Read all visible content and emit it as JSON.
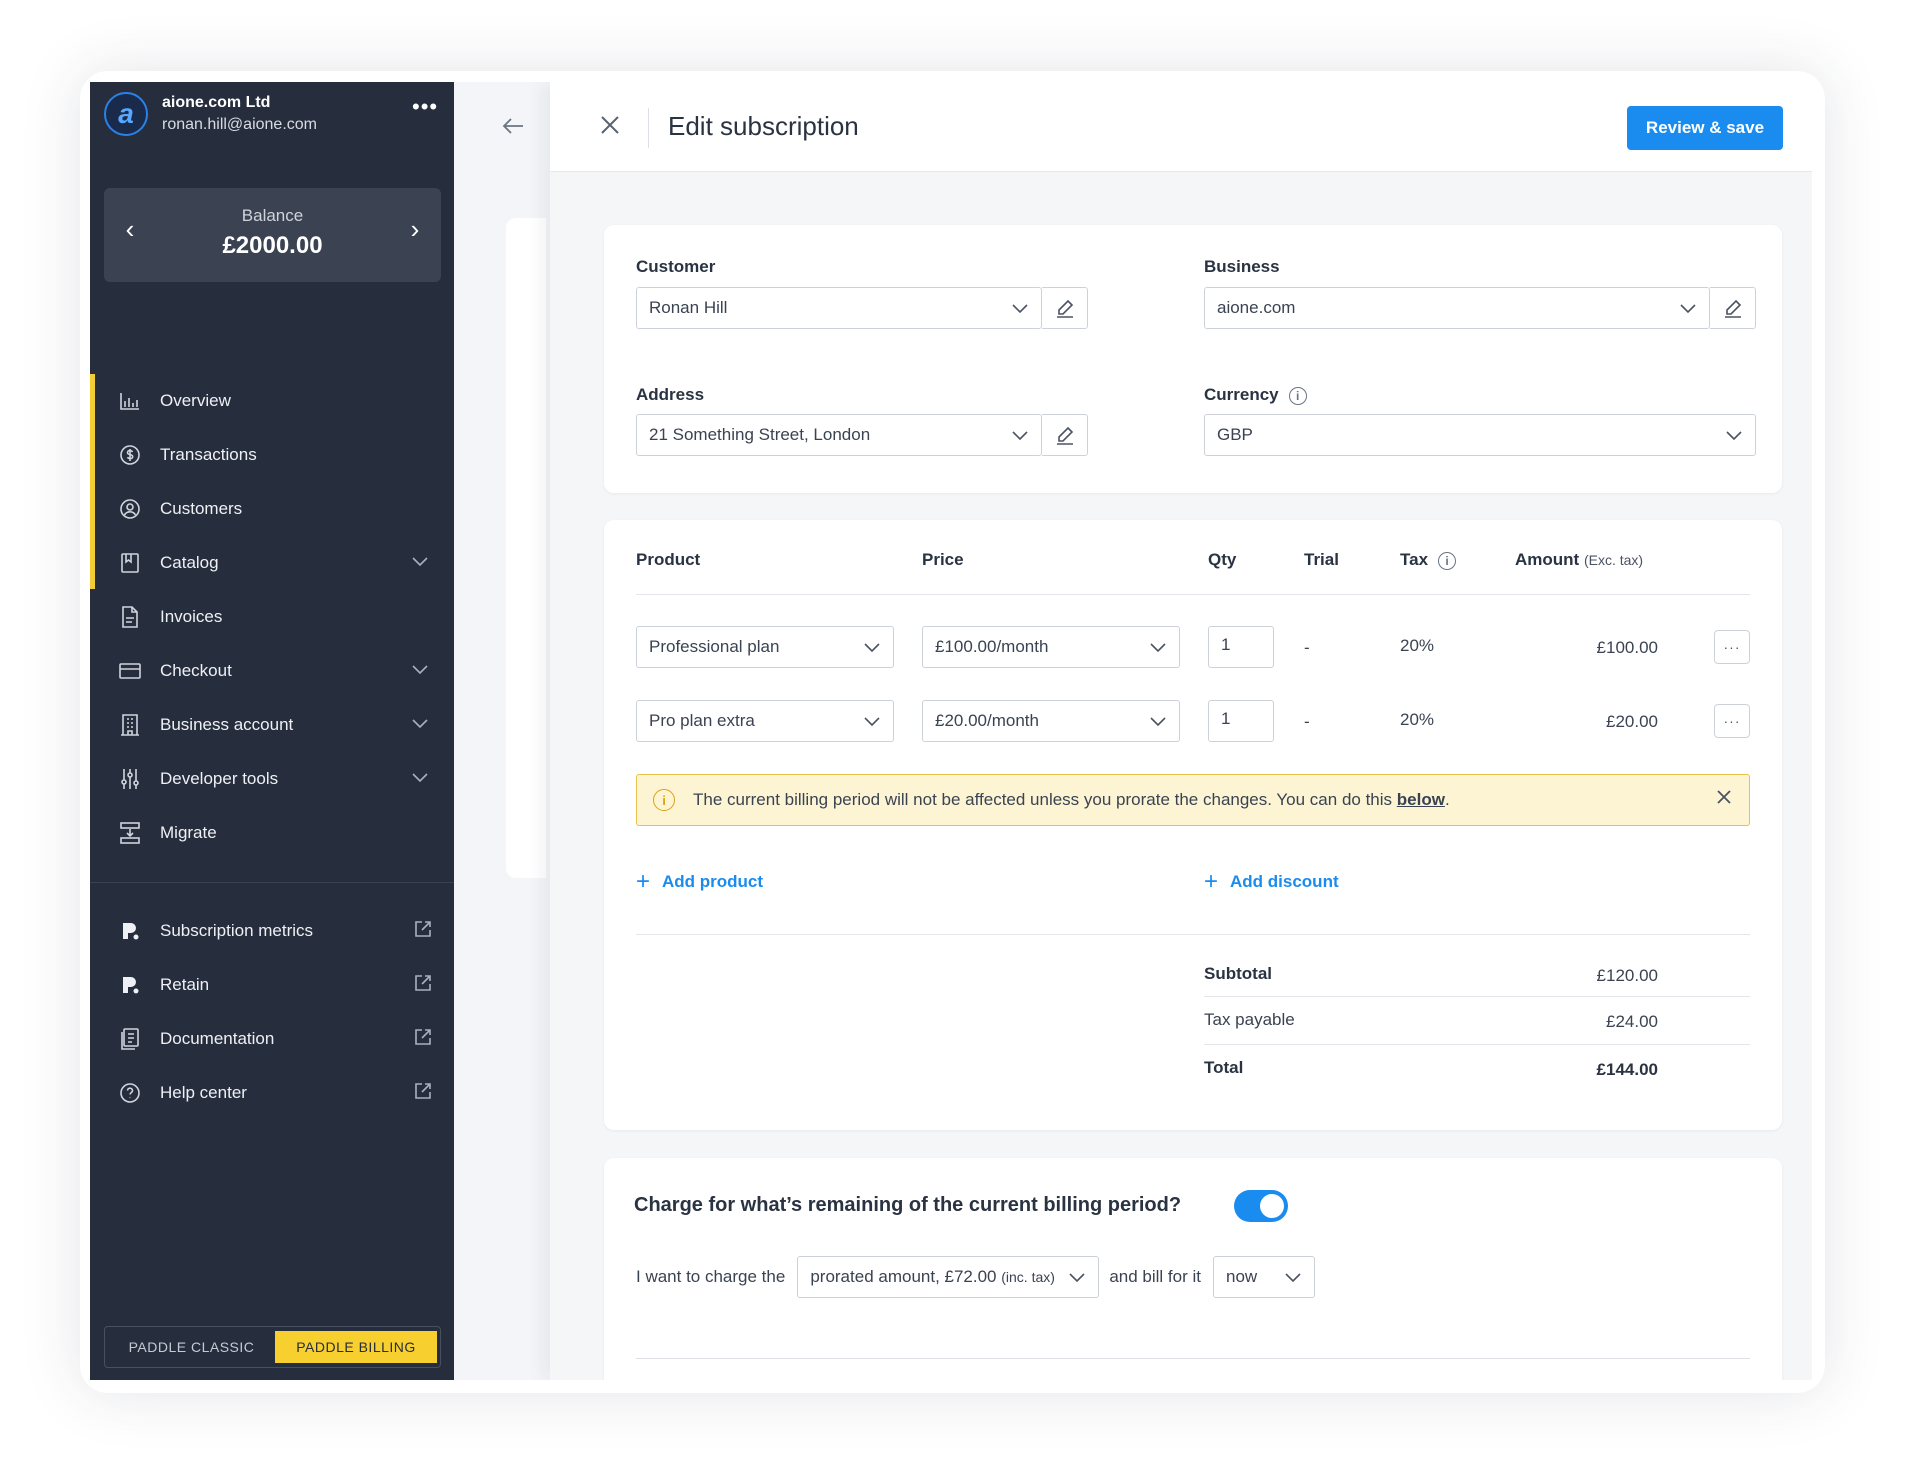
{
  "account": {
    "logo": "a",
    "name": "aione.com Ltd",
    "email": "ronan.hill@aione.com",
    "more_icon": "more-horizontal-icon"
  },
  "balance": {
    "label": "Balance",
    "value": "£2000.00"
  },
  "nav": [
    {
      "label": "Overview",
      "icon": "chart-icon"
    },
    {
      "label": "Transactions",
      "icon": "dollar-circle-icon"
    },
    {
      "label": "Customers",
      "icon": "user-circle-icon"
    },
    {
      "label": "Catalog",
      "icon": "catalog-icon",
      "expandable": true
    },
    {
      "label": "Invoices",
      "icon": "document-icon"
    },
    {
      "label": "Checkout",
      "icon": "credit-card-icon",
      "expandable": true
    },
    {
      "label": "Business account",
      "icon": "building-icon",
      "expandable": true
    },
    {
      "label": "Developer tools",
      "icon": "sliders-icon",
      "expandable": true
    },
    {
      "label": "Migrate",
      "icon": "migrate-icon"
    }
  ],
  "external_nav": [
    {
      "label": "Subscription metrics",
      "icon": "profitwell-icon"
    },
    {
      "label": "Retain",
      "icon": "profitwell-icon"
    },
    {
      "label": "Documentation",
      "icon": "docs-icon"
    },
    {
      "label": "Help center",
      "icon": "help-circle-icon"
    }
  ],
  "mode": {
    "classic": "PADDLE CLASSIC",
    "billing": "PADDLE BILLING",
    "active": "billing"
  },
  "panel": {
    "title": "Edit subscription",
    "review_label": "Review & save"
  },
  "form": {
    "customer_label": "Customer",
    "customer_value": "Ronan Hill",
    "business_label": "Business",
    "business_value": "aione.com",
    "address_label": "Address",
    "address_value": "21 Something Street, London",
    "currency_label": "Currency",
    "currency_value": "GBP"
  },
  "items_table": {
    "headers": {
      "product": "Product",
      "price": "Price",
      "qty": "Qty",
      "trial": "Trial",
      "tax": "Tax",
      "amount": "Amount",
      "amount_note": "(Exc. tax)"
    },
    "rows": [
      {
        "product": "Professional plan",
        "price": "£100.00/month",
        "qty": "1",
        "trial": "-",
        "tax": "20%",
        "amount": "£100.00"
      },
      {
        "product": "Pro plan extra",
        "price": "£20.00/month",
        "qty": "1",
        "trial": "-",
        "tax": "20%",
        "amount": "£20.00"
      }
    ]
  },
  "notice": {
    "text": "The current billing period will not be affected unless you prorate the changes. You can do this ",
    "link": "below",
    "end": "."
  },
  "actions": {
    "add_product": "Add product",
    "add_discount": "Add discount"
  },
  "totals": {
    "subtotal_label": "Subtotal",
    "subtotal": "£120.00",
    "tax_label": "Tax payable",
    "tax": "£24.00",
    "total_label": "Total",
    "total": "£144.00"
  },
  "proration": {
    "question": "Charge for what’s remaining of the current billing period?",
    "enabled": true,
    "prefix": "I want to charge the",
    "amount_option": "prorated amount, £72.00",
    "amount_note": "(inc. tax)",
    "middle": "and bill for it",
    "when_option": "now"
  },
  "colors": {
    "accent": "#1a8cf0",
    "sidebar": "#262d3d",
    "highlight": "#f7cf2f",
    "notice_bg": "#fdf4d3"
  }
}
